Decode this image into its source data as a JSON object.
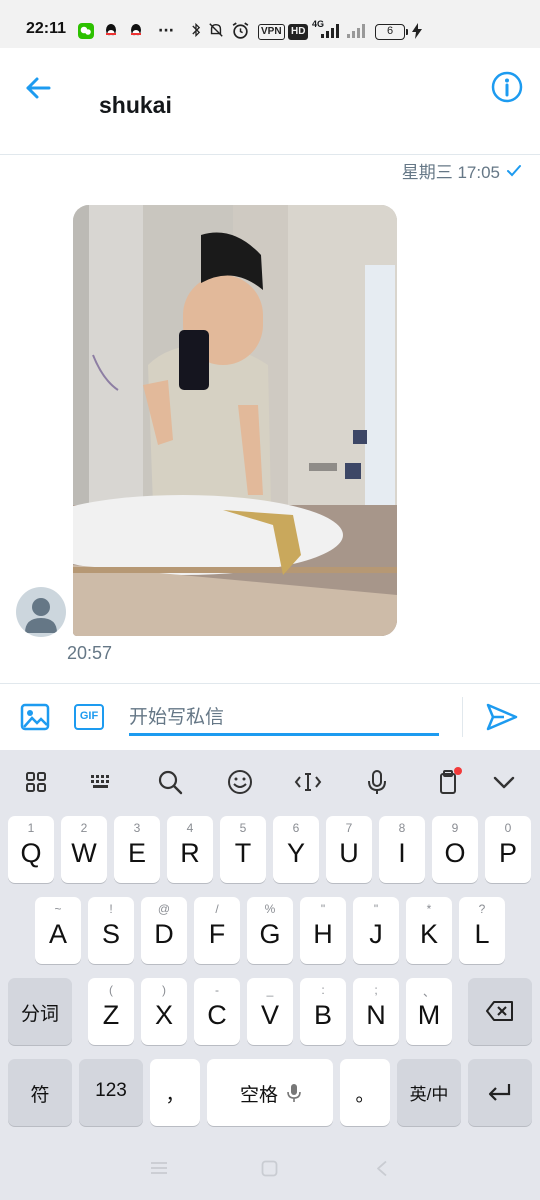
{
  "status_bar": {
    "time": "22:11",
    "app_icons": [
      "wechat-icon",
      "qq-icon",
      "qq-icon"
    ],
    "more": "···",
    "vpn_badge": "VPN",
    "hd_badge": "HD",
    "network": "4G",
    "battery_level": "6"
  },
  "header": {
    "title": "shukai"
  },
  "conversation": {
    "sent_timestamp": "星期三 17:05",
    "received_time": "20:57"
  },
  "composer": {
    "gif_label": "GIF",
    "placeholder": "开始写私信"
  },
  "keyboard": {
    "row1": [
      {
        "hint": "1",
        "label": "Q"
      },
      {
        "hint": "2",
        "label": "W"
      },
      {
        "hint": "3",
        "label": "E"
      },
      {
        "hint": "4",
        "label": "R"
      },
      {
        "hint": "5",
        "label": "T"
      },
      {
        "hint": "6",
        "label": "Y"
      },
      {
        "hint": "7",
        "label": "U"
      },
      {
        "hint": "8",
        "label": "I"
      },
      {
        "hint": "9",
        "label": "O"
      },
      {
        "hint": "0",
        "label": "P"
      }
    ],
    "row2": [
      {
        "hint": "~",
        "label": "A"
      },
      {
        "hint": "!",
        "label": "S"
      },
      {
        "hint": "@",
        "label": "D"
      },
      {
        "hint": "/",
        "label": "F"
      },
      {
        "hint": "%",
        "label": "G"
      },
      {
        "hint": "\"",
        "label": "H"
      },
      {
        "hint": "\"",
        "label": "J"
      },
      {
        "hint": "*",
        "label": "K"
      },
      {
        "hint": "?",
        "label": "L"
      }
    ],
    "row3": [
      {
        "hint": "(",
        "label": "Z"
      },
      {
        "hint": ")",
        "label": "X"
      },
      {
        "hint": "-",
        "label": "C"
      },
      {
        "hint": "_",
        "label": "V"
      },
      {
        "hint": ":",
        "label": "B"
      },
      {
        "hint": ";",
        "label": "N"
      },
      {
        "hint": "、",
        "label": "M"
      }
    ],
    "segment_key": "分词",
    "symbol_key": "符",
    "number_key": "123",
    "comma_key": "，",
    "space_key": "空格",
    "period_key": "。",
    "lang_key": "英/中"
  },
  "colors": {
    "accent": "#1d9bf0",
    "keyboard_bg": "#e4e6ec",
    "muted_text": "#657786"
  }
}
